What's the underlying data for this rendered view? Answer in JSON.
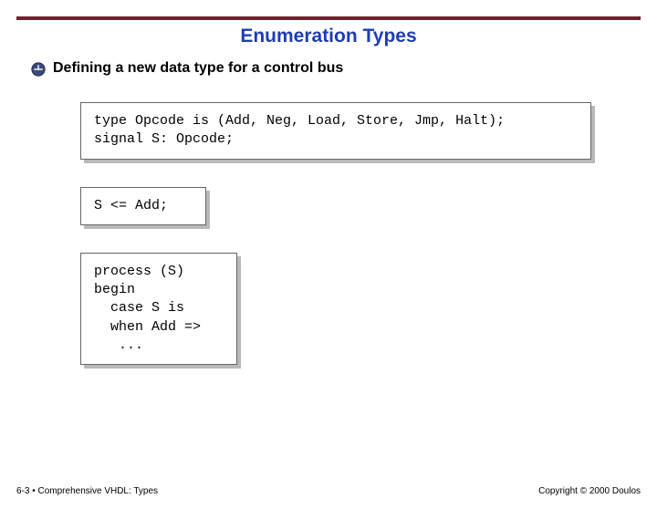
{
  "title": "Enumeration Types",
  "bullet": "Defining a new data type for a control bus",
  "code1": "type Opcode is (Add, Neg, Load, Store, Jmp, Halt);\nsignal S: Opcode;",
  "code2": "S <= Add;",
  "code3": "process (S)\nbegin\n  case S is\n  when Add =>\n   ...",
  "footer": {
    "left": "6-3  •  Comprehensive VHDL: Types",
    "right": "Copyright © 2000 Doulos"
  }
}
